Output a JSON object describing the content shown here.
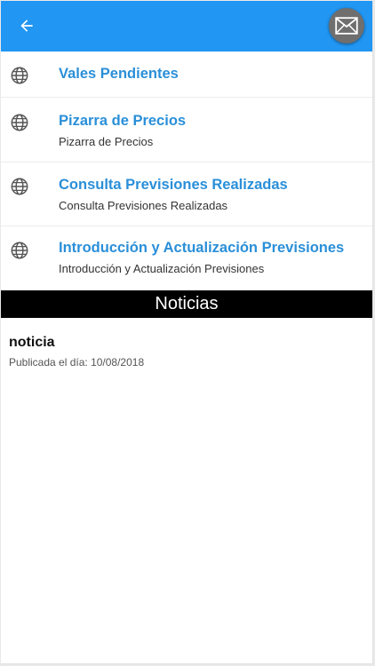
{
  "header": {
    "background_color": "#2196f3",
    "back_icon": "arrow-left-icon",
    "mail_icon": "envelope-icon"
  },
  "menu": {
    "icon": "globe-icon",
    "title_color": "#2a8fd8",
    "items": [
      {
        "title": "Vales Pendientes",
        "subtitle": ""
      },
      {
        "title": "Pizarra de Precios",
        "subtitle": "Pizarra de Precios"
      },
      {
        "title": "Consulta Previsiones Realizadas",
        "subtitle": "Consulta Previsiones Realizadas"
      },
      {
        "title": "Introducción y Actualización Previsiones",
        "subtitle": "Introducción y Actualización Previsiones"
      }
    ]
  },
  "news": {
    "heading": "Noticias",
    "items": [
      {
        "title": "noticia",
        "date": "Publicada el día: 10/08/2018"
      }
    ]
  }
}
